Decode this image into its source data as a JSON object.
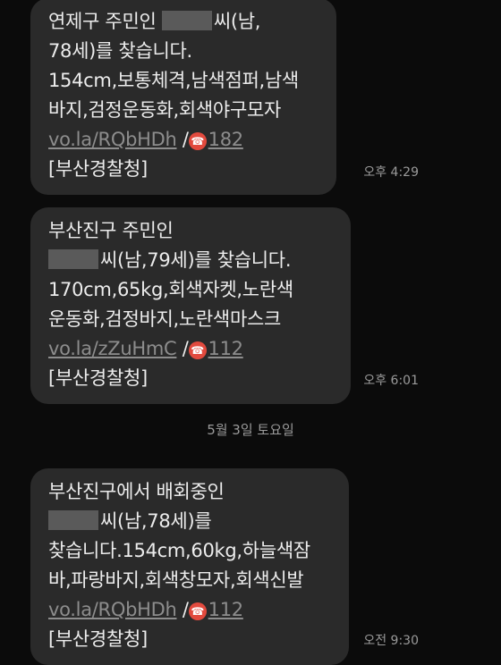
{
  "messages": [
    {
      "lines": [
        {
          "before": "연제구 주민인 ",
          "redacted": true,
          "after": "씨(남,"
        },
        {
          "text": "78세)를 찾습니다."
        },
        {
          "text": "154cm,보통체격,남색점퍼,남색"
        },
        {
          "text": "바지,검정운동화,회색야구모자"
        },
        {
          "link": "vo.la/RQbHDh",
          "sep": " /",
          "phone": "182"
        },
        {
          "text": "[부산경찰청]"
        }
      ],
      "time": "오후 4:29"
    },
    {
      "lines": [
        {
          "text": "부산진구 주민인"
        },
        {
          "before": "",
          "redacted": true,
          "after": "씨(남,79세)를 찾습니다."
        },
        {
          "text": "170cm,65kg,회색자켓,노란색"
        },
        {
          "text": "운동화,검정바지,노란색마스크"
        },
        {
          "link": "vo.la/zZuHmC",
          "sep": " /",
          "phone": "112"
        },
        {
          "text": "[부산경찰청]"
        }
      ],
      "time": "오후 6:01"
    },
    {
      "lines": [
        {
          "text": "부산진구에서 배회중인"
        },
        {
          "before": "",
          "redacted": true,
          "after": "씨(남,78세)를"
        },
        {
          "text": "찾습니다.154cm,60kg,하늘색잠"
        },
        {
          "text": "바,파랑바지,회색창모자,회색신발"
        },
        {
          "link": "vo.la/RQbHDh",
          "sep": " /",
          "phone": "112"
        },
        {
          "text": "[부산경찰청]"
        }
      ],
      "time": "오전 9:30"
    }
  ],
  "date_separator": "5월 3일 토요일",
  "icons": {
    "phone": "phone-icon"
  }
}
